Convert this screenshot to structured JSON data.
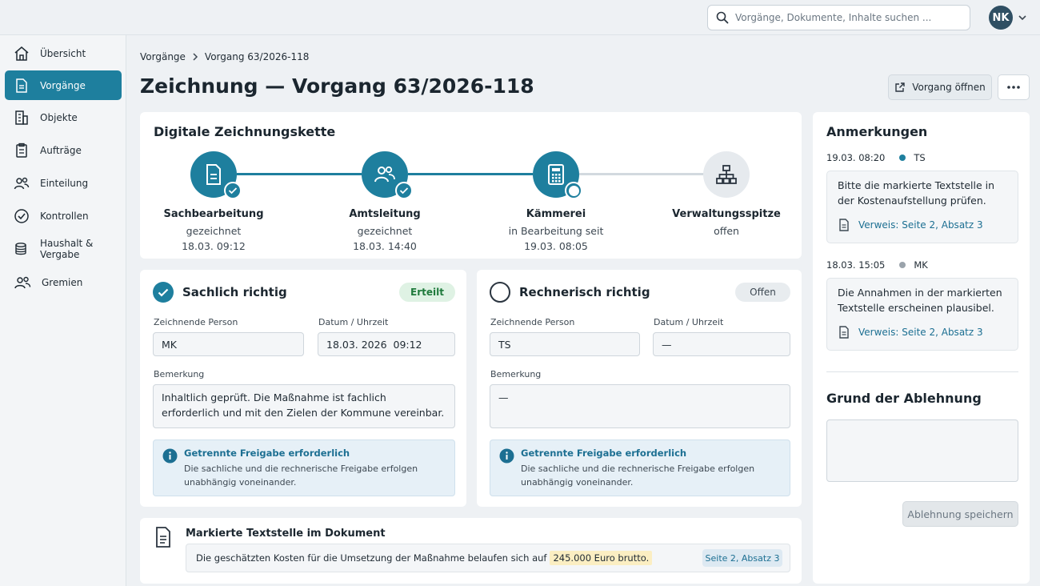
{
  "header": {
    "search_placeholder": "Vorgänge, Dokumente, Inhalte suchen ...",
    "avatar_initials": "NK"
  },
  "sidebar": {
    "items": [
      {
        "label": "Übersicht",
        "icon": "home-icon",
        "active": false
      },
      {
        "label": "Vorgänge",
        "icon": "document-icon",
        "active": true
      },
      {
        "label": "Objekte",
        "icon": "building-icon",
        "active": false
      },
      {
        "label": "Aufträge",
        "icon": "clipboard-icon",
        "active": false
      },
      {
        "label": "Einteilung",
        "icon": "users-icon",
        "active": false
      },
      {
        "label": "Kontrollen",
        "icon": "check-circle-icon",
        "active": false
      },
      {
        "label": "Haushalt & Vergabe",
        "icon": "coins-icon",
        "active": false
      },
      {
        "label": "Gremien",
        "icon": "group-icon",
        "active": false
      }
    ]
  },
  "breadcrumb": {
    "root": "Vorgänge",
    "current": "Vorgang 63/2026-118"
  },
  "page": {
    "title": "Zeichnung — Vorgang 63/2026-118",
    "open_button": "Vorgang öffnen"
  },
  "chain": {
    "title": "Digitale Zeichnungskette",
    "steps": [
      {
        "name": "Sachbearbeitung",
        "status": "gezeichnet",
        "time": "18.03. 09:12",
        "icon": "document-icon",
        "state": "done"
      },
      {
        "name": "Amtsleitung",
        "status": "gezeichnet",
        "time": "18.03. 14:40",
        "icon": "users-icon",
        "state": "done"
      },
      {
        "name": "Kämmerei",
        "status": "in Bearbeitung seit",
        "time": "19.03. 08:05",
        "icon": "calculator-icon",
        "state": "active"
      },
      {
        "name": "Verwaltungsspitze",
        "status": "offen",
        "time": "",
        "icon": "org-chart-icon",
        "state": "open"
      }
    ]
  },
  "panel_sachlich": {
    "title": "Sachlich richtig",
    "status": "Erteilt",
    "person_label": "Zeichnende Person",
    "person": "MK",
    "datetime_label": "Datum / Uhrzeit",
    "datetime": "18.03. 2026  09:12",
    "remark_label": "Bemerkung",
    "remark": "Inhaltlich geprüft. Die Maßnahme ist fachlich erforderlich und mit den Zielen der Kommune vereinbar.",
    "info_title": "Getrennte Freigabe erforderlich",
    "info_text": "Die sachliche und die rechnerische Freigabe erfolgen unabhängig voneinander."
  },
  "panel_rechnerisch": {
    "title": "Rechnerisch richtig",
    "status": "Offen",
    "person_label": "Zeichnende Person",
    "person": "TS",
    "datetime_label": "Datum / Uhrzeit",
    "datetime": "—",
    "remark_label": "Bemerkung",
    "remark": "—",
    "info_title": "Getrennte Freigabe erforderlich",
    "info_text": "Die sachliche und die rechnerische Freigabe erfolgen unabhängig voneinander."
  },
  "marked": {
    "title": "Markierte Textstelle im Dokument",
    "text": "Die geschätzten Kosten für die Umsetzung der Maßnahme belaufen sich auf",
    "highlight": "245.000 Euro brutto.",
    "ref": "Seite 2, Absatz 3"
  },
  "notes": {
    "title": "Anmerkungen",
    "items": [
      {
        "time": "19.03. 08:20",
        "author": "TS",
        "dot_color": "#1e7f9e",
        "text": "Bitte die markierte Textstelle in der Kostenaufstellung prüfen.",
        "ref": "Verweis: Seite 2, Absatz 3"
      },
      {
        "time": "18.03. 15:05",
        "author": "MK",
        "dot_color": "#9aa3ab",
        "text": "Die Annahmen in der markierten Textstelle erscheinen plausibel.",
        "ref": "Verweis: Seite 2, Absatz 3"
      }
    ],
    "reject_title": "Grund der Ablehnung",
    "reject_value": "",
    "save_button": "Ablehnung speichern"
  },
  "colors": {
    "accent": "#1e7f9e",
    "success_bg": "#dff2e4",
    "success_text": "#1f7a3c"
  }
}
